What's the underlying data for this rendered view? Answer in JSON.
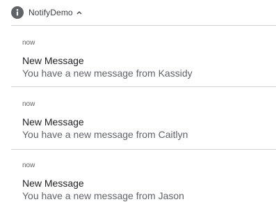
{
  "header": {
    "app_icon": "info-icon",
    "app_name": "NotifyDemo",
    "expand_icon": "chevron-up-icon"
  },
  "notifications": [
    {
      "time": "now",
      "title": "New Message",
      "body": "You have a new message from Kassidy"
    },
    {
      "time": "now",
      "title": "New Message",
      "body": "You have a new message from Caitlyn"
    },
    {
      "time": "now",
      "title": "New Message",
      "body": "You have a new message from Jason"
    }
  ]
}
